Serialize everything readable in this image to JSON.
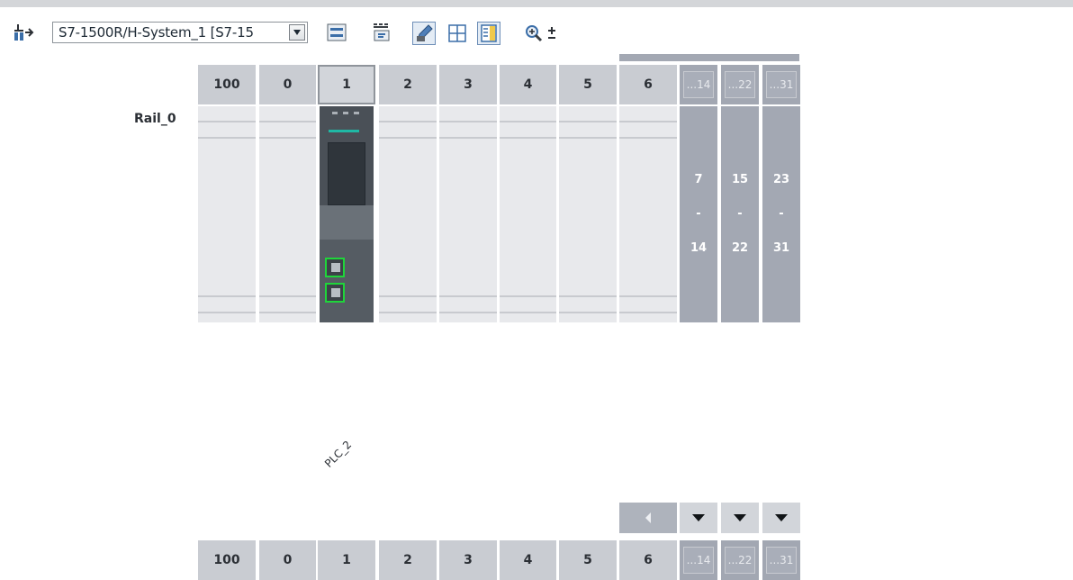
{
  "toolbar": {
    "device_select_value": "S7-1500R/H-System_1 [S7-15",
    "icons": [
      "topology-icon",
      "dropdown-arrow-icon",
      "rail-icon",
      "names-icon",
      "pencil-icon",
      "grid-icon",
      "overview-icon",
      "zoom-icon",
      "zoom-step-icon"
    ]
  },
  "rail_top": {
    "label": "Rail_0",
    "slot_headers": [
      "100",
      "0",
      "1",
      "2",
      "3",
      "4",
      "5",
      "6"
    ],
    "group_headers": [
      "...14",
      "...22",
      "...31"
    ],
    "group_slots": [
      {
        "from": "7",
        "sep": "-",
        "to": "14"
      },
      {
        "from": "15",
        "sep": "-",
        "to": "22"
      },
      {
        "from": "23",
        "sep": "-",
        "to": "31"
      }
    ]
  },
  "device_label": "PLC_2",
  "rail_bottom": {
    "slot_headers": [
      "100",
      "0",
      "1",
      "2",
      "3",
      "4",
      "5",
      "6"
    ],
    "group_headers": [
      "...14",
      "...22",
      "...31"
    ]
  },
  "colors": {
    "header": "#c9ccd2",
    "slot": "#e8e9ec",
    "group": "#a3a8b3",
    "cpu": "#4a5057",
    "port_highlight": "#1fd53a",
    "brand": "#1fb9a5"
  }
}
